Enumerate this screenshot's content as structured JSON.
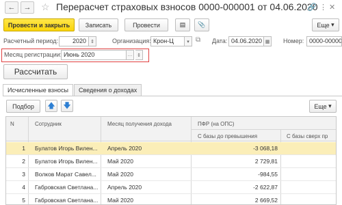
{
  "window": {
    "title": "Перерасчет страховых взносов 0000-000001 от 04.06.2020"
  },
  "toolbar": {
    "post_close": "Провести и закрыть",
    "save": "Записать",
    "post": "Провести",
    "more": "Еще"
  },
  "header": {
    "period_label": "Расчетный период:",
    "period_value": "2020",
    "org_label": "Организация:",
    "org_value": "Крон-Ц",
    "date_label": "Дата:",
    "date_value": "04.06.2020",
    "number_label": "Номер:",
    "number_value": "0000-00000",
    "month_label": "Месяц регистрации:",
    "month_value": "Июнь 2020"
  },
  "calc_button": "Рассчитать",
  "tabs": [
    {
      "label": "Исчисленные взносы"
    },
    {
      "label": "Сведения о доходах"
    }
  ],
  "subtoolbar": {
    "select": "Подбор",
    "more": "Еще"
  },
  "table": {
    "columns": {
      "n": "N",
      "employee": "Сотрудник",
      "month": "Месяц получения дохода",
      "pfr": "ПФР (на ОПС)",
      "base_below": "С базы до превышения",
      "base_above": "С базы сверх пр"
    },
    "rows": [
      {
        "n": "1",
        "employee": "Булатов Игорь Вилен...",
        "month": "Апрель 2020",
        "value": "-3 068,18"
      },
      {
        "n": "2",
        "employee": "Булатов Игорь Вилен...",
        "month": "Май 2020",
        "value": "2 729,81"
      },
      {
        "n": "3",
        "employee": "Волков Марат Савел...",
        "month": "Май 2020",
        "value": "-984,55"
      },
      {
        "n": "4",
        "employee": "Габровская Светлана...",
        "month": "Апрель 2020",
        "value": "-2 622,87"
      },
      {
        "n": "5",
        "employee": "Габровская Светлана...",
        "month": "Май 2020",
        "value": "2 669,52"
      }
    ]
  },
  "colors": {
    "primary_button": "#f9d40a",
    "selected_row": "#fbeeb8",
    "highlight_border": "#e04040",
    "arrow_icon": "#2d7fd3"
  }
}
